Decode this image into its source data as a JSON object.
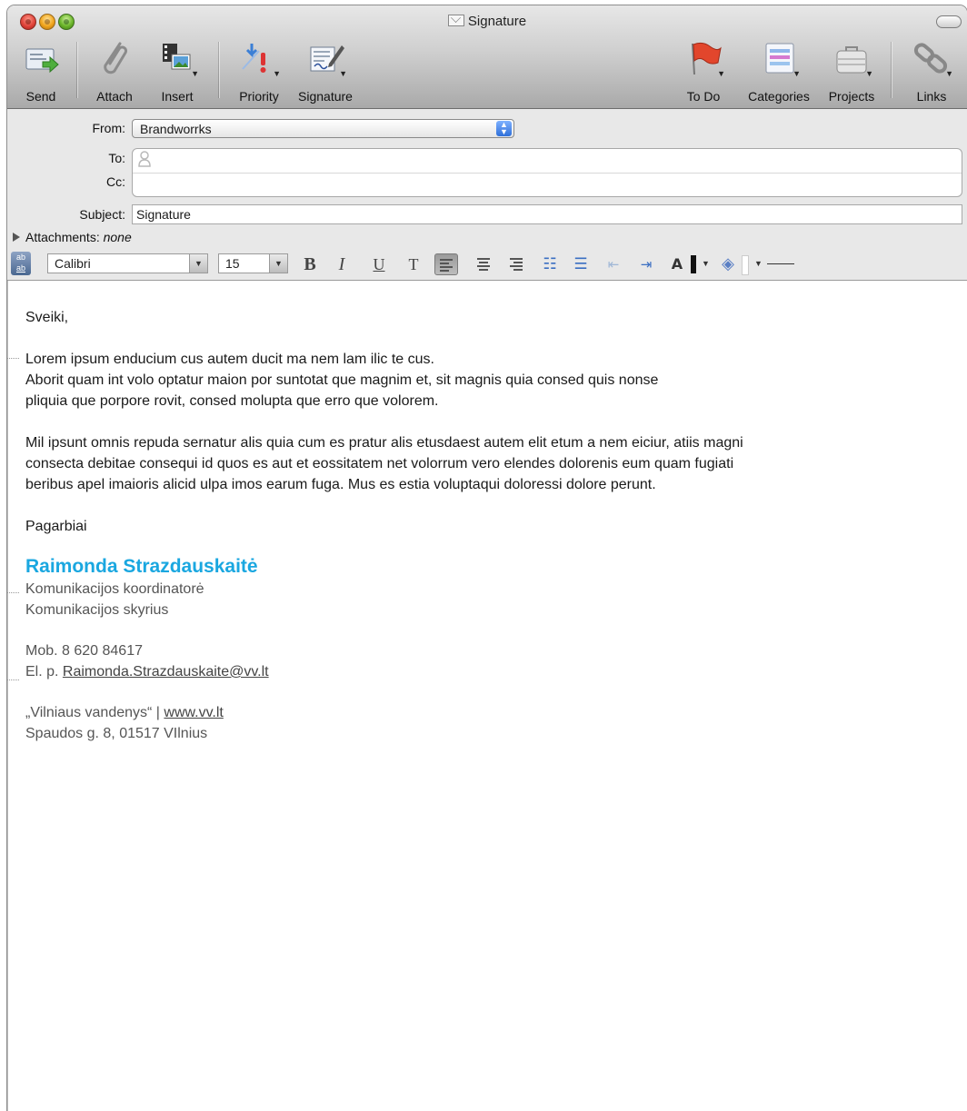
{
  "window": {
    "title": "Signature"
  },
  "toolbar": {
    "send": "Send",
    "attach": "Attach",
    "insert": "Insert",
    "priority": "Priority",
    "signature": "Signature",
    "todo": "To Do",
    "categories": "Categories",
    "projects": "Projects",
    "links": "Links"
  },
  "header": {
    "from_label": "From:",
    "from_value": "Brandworrks",
    "to_label": "To:",
    "cc_label": "Cc:",
    "subject_label": "Subject:",
    "subject_value": "Signature",
    "attachments_label": "Attachments:",
    "attachments_value": "none"
  },
  "format_bar": {
    "font": "Calibri",
    "size": "15",
    "bold": "B",
    "italic": "I",
    "underline": "U",
    "text_style": "T"
  },
  "message": {
    "greeting": "Sveiki,",
    "para1": [
      "Lorem ipsum enducium cus autem ducit ma nem lam ilic te cus.",
      "Aborit quam int volo optatur maion por suntotat que magnim et, sit magnis quia consed quis nonse",
      "pliquia que porpore rovit, consed molupta que erro que volorem."
    ],
    "para2": [
      "Mil ipsunt omnis repuda sernatur alis quia cum es pratur alis etusdaest autem elit etum a nem eiciur, atiis magni",
      "consecta debitae consequi id quos es aut et eossitatem net volorrum vero elendes dolorenis eum quam fugiati",
      "beribus apel imaioris alicid ulpa imos earum fuga. Mus es estia voluptaqui doloressi dolore perunt."
    ],
    "closing": "Pagarbiai"
  },
  "signature": {
    "name": "Raimonda Strazdauskaitė",
    "title": "Komunikacijos koordinatorė",
    "department": "Komunikacijos skyrius",
    "mobile": "Mob. 8 620 84617",
    "email_prefix": "El. p. ",
    "email": "Raimonda.Strazdauskaite@vv.lt",
    "company": "„Vilniaus vandenys“ | ",
    "website": "www.vv.lt",
    "address": "Spaudos g. 8, 01517 VIlnius"
  },
  "colors": {
    "name_accent": "#1aa7e0"
  }
}
